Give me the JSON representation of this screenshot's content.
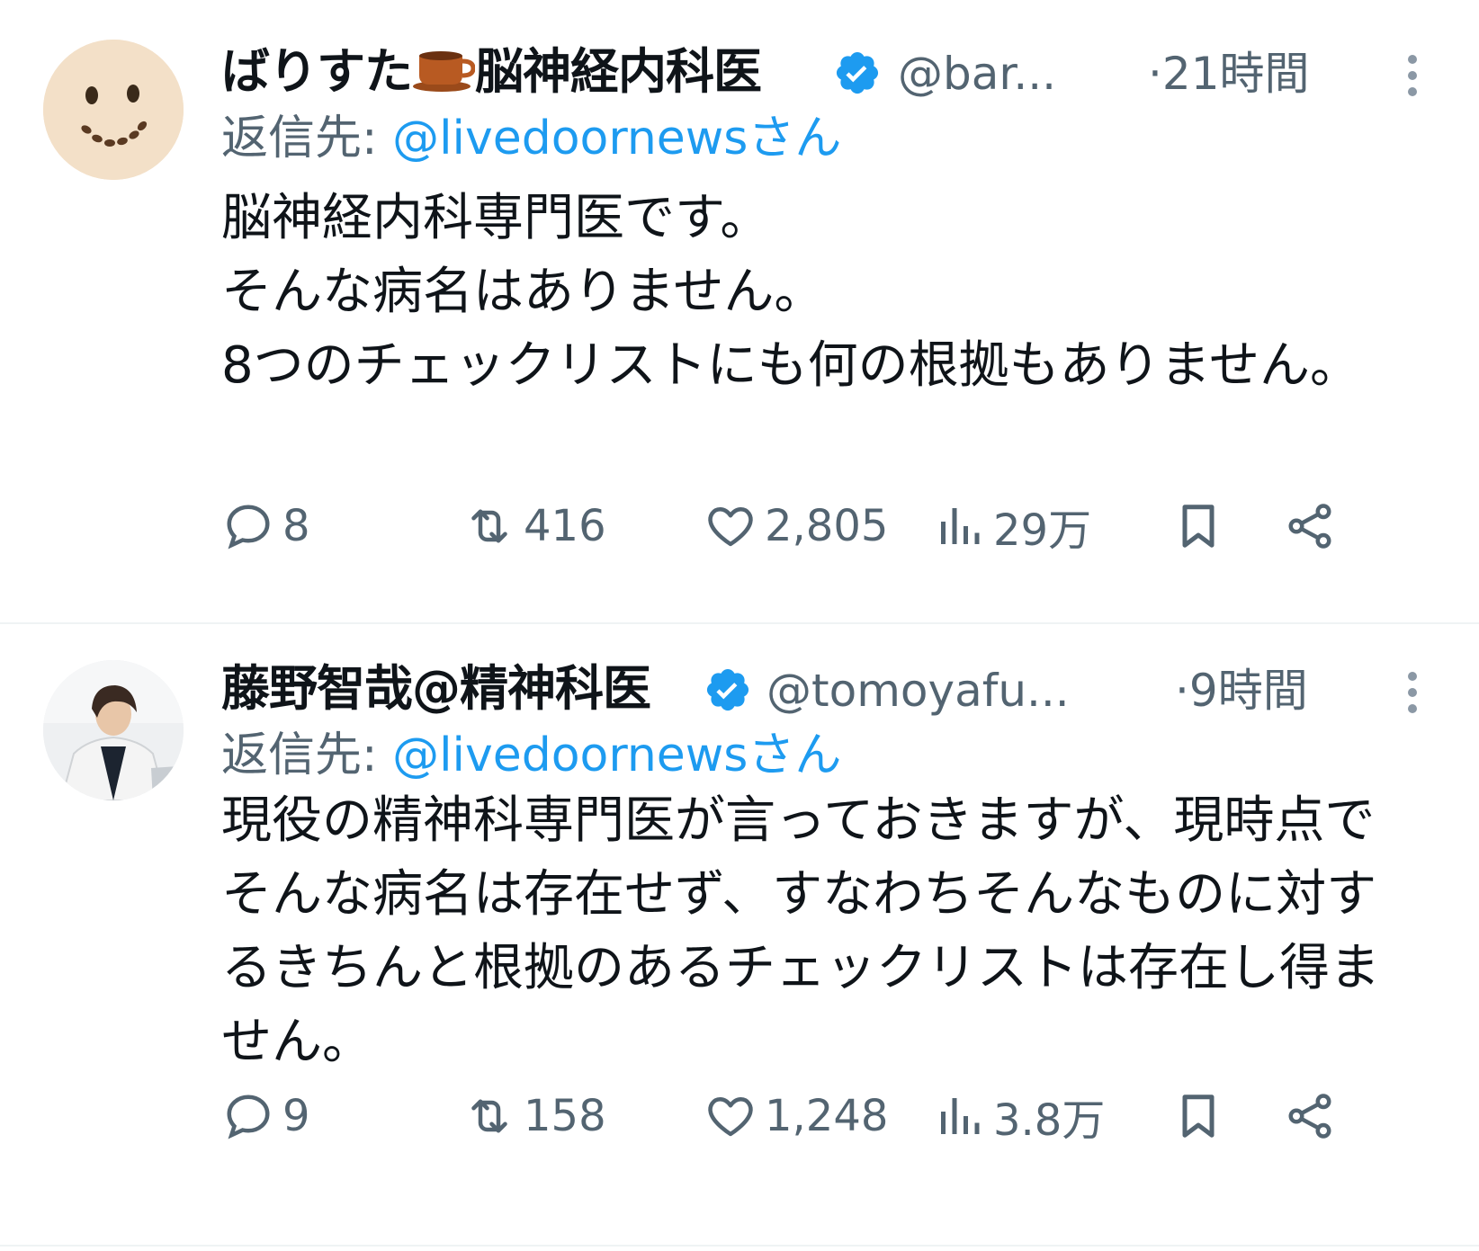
{
  "tweets": [
    {
      "display_name": "ばりすた",
      "name_suffix": "脳神経内科医",
      "emoji_icon": "coffee-cup-icon",
      "handle": "@bar...",
      "time": "·21時間",
      "reply_label": "返信先:",
      "reply_target": "@livedoornewsさん",
      "body": "脳神経内科専門医です。\nそんな病名はありません。\n8つのチェックリストにも何の根拠もありません。",
      "actions": {
        "replies": "8",
        "reposts": "416",
        "likes": "2,805",
        "views": "29万"
      },
      "avatar_icon": "smiley-face-avatar"
    },
    {
      "display_name": "藤野智哉@精神科医",
      "handle": "@tomoyafu...",
      "time": "·9時間",
      "reply_label": "返信先:",
      "reply_target": "@livedoornewsさん",
      "body": "現役の精神科専門医が言っておきますが、現時点でそんな病名は存在せず、すなわちそんなものに対するきちんと根拠のあるチェックリストは存在し得ません。",
      "actions": {
        "replies": "9",
        "reposts": "158",
        "likes": "1,248",
        "views": "3.8万"
      },
      "avatar_icon": "person-photo-avatar"
    }
  ],
  "colors": {
    "text": "#0f1419",
    "secondary": "#536471",
    "link": "#1d9bf0",
    "verified": "#1d9bf0",
    "divider": "#eff3f4"
  }
}
